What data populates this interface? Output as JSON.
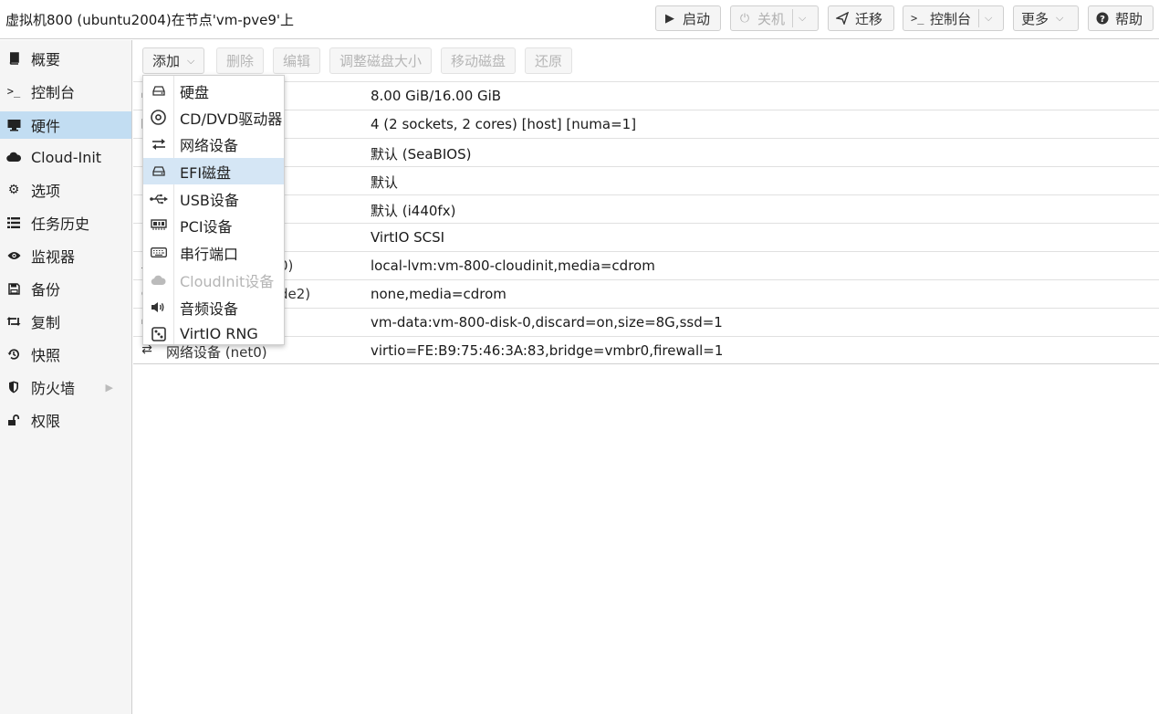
{
  "window": {
    "title": "虚拟机800 (ubuntu2004)在节点'vm-pve9'上"
  },
  "header_buttons": {
    "start": "启动",
    "shutdown": "关机",
    "migrate": "迁移",
    "console": "控制台",
    "more": "更多",
    "help": "帮助"
  },
  "sidebar": {
    "items": [
      {
        "label": "概要",
        "icon": "book-icon"
      },
      {
        "label": "控制台",
        "icon": "terminal-icon"
      },
      {
        "label": "硬件",
        "icon": "monitor-icon",
        "active": true
      },
      {
        "label": "Cloud-Init",
        "icon": "cloud-icon"
      },
      {
        "label": "选项",
        "icon": "gear-icon"
      },
      {
        "label": "任务历史",
        "icon": "list-icon"
      },
      {
        "label": "监视器",
        "icon": "eye-icon"
      },
      {
        "label": "备份",
        "icon": "save-icon"
      },
      {
        "label": "复制",
        "icon": "retweet-icon"
      },
      {
        "label": "快照",
        "icon": "history-icon"
      },
      {
        "label": "防火墙",
        "icon": "shield-icon"
      },
      {
        "label": "权限",
        "icon": "unlock-icon"
      }
    ]
  },
  "toolbar": {
    "add": "添加",
    "remove": "删除",
    "edit": "编辑",
    "resize_disk": "调整磁盘大小",
    "move_disk": "移动磁盘",
    "revert": "还原"
  },
  "hardware_rows": [
    {
      "name": "",
      "value": "8.00 GiB/16.00 GiB"
    },
    {
      "name": "",
      "value": "4 (2 sockets, 2 cores) [host] [numa=1]"
    },
    {
      "name": "",
      "value": "默认 (SeaBIOS)"
    },
    {
      "name": "",
      "value": "默认"
    },
    {
      "name": "",
      "value": "默认 (i440fx)"
    },
    {
      "name": "",
      "value": "VirtIO SCSI"
    },
    {
      "name": "0)",
      "value": "local-lvm:vm-800-cloudinit,media=cdrom"
    },
    {
      "name": "de2)",
      "value": "none,media=cdrom"
    },
    {
      "name": "",
      "value": "vm-data:vm-800-disk-0,discard=on,size=8G,ssd=1"
    },
    {
      "name": "网络设备 (net0)",
      "value": "virtio=FE:B9:75:46:3A:83,bridge=vmbr0,firewall=1"
    }
  ],
  "add_menu": {
    "items": [
      {
        "label": "硬盘",
        "icon": "hdd-icon"
      },
      {
        "label": "CD/DVD驱动器",
        "icon": "disc-icon"
      },
      {
        "label": "网络设备",
        "icon": "exchange-icon"
      },
      {
        "label": "EFI磁盘",
        "icon": "hdd-icon",
        "highlighted": true
      },
      {
        "label": "USB设备",
        "icon": "usb-icon"
      },
      {
        "label": "PCI设备",
        "icon": "pci-card-icon"
      },
      {
        "label": "串行端口",
        "icon": "keyboard-icon"
      },
      {
        "label": "CloudInit设备",
        "icon": "cloud-icon",
        "disabled": true
      },
      {
        "label": "音频设备",
        "icon": "volume-icon"
      },
      {
        "label": "VirtIO RNG",
        "icon": "dice-icon"
      }
    ]
  },
  "colors": {
    "active_nav": "#c2ddf2",
    "menu_hover": "#d5e6f5",
    "disabled_text": "#b5b5b5"
  }
}
